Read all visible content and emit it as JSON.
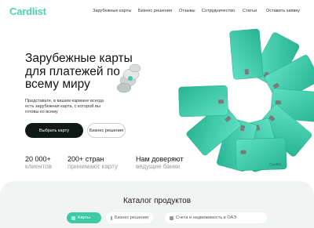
{
  "header": {
    "logo": "Cardlist",
    "nav": [
      {
        "label": "Зарубежные карты"
      },
      {
        "label": "Бизнес решения"
      },
      {
        "label": "Отзывы"
      },
      {
        "label": "Сотрудничество"
      },
      {
        "label": "Статьи"
      },
      {
        "label": "Оставить заявку"
      }
    ]
  },
  "hero": {
    "title": "Зарубежные карты для платежей по всему миру",
    "description": "Представьте, в вашем кармане всегда есть зарубежная карта, с которой вы готовы ко всему",
    "primary_button": "Выбрать карту",
    "secondary_button": "Бизнес решения"
  },
  "stats": [
    {
      "value": "20 000+",
      "caption": "клиентов"
    },
    {
      "value": "200+ стран",
      "caption": "принимают карту"
    },
    {
      "value": "Нам доверяют",
      "caption": "ведущие банки"
    }
  ],
  "catalog": {
    "title": "Каталог продуктов",
    "tabs": [
      {
        "label": "Карты"
      },
      {
        "label": "Бизнес решения"
      },
      {
        "label": "Счета и недвижимость в ОАЭ"
      }
    ]
  },
  "card_brand": "Cardlist",
  "colors": {
    "accent": "#3ec9a7",
    "logo": "#4fd1b4",
    "dark_button": "#0f1a17",
    "catalog_bg": "#f2f3f3"
  },
  "icons": [
    "coin-stack-icon",
    "card-icon",
    "briefcase-icon",
    "building-icon"
  ]
}
